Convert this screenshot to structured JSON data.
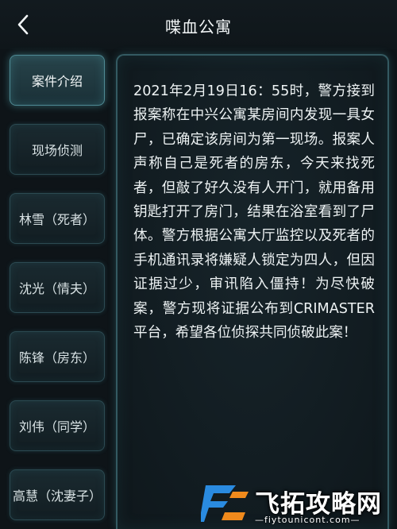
{
  "header": {
    "back_icon": "chevron-left-icon",
    "title": "喋血公寓"
  },
  "sidebar": {
    "items": [
      {
        "label": "案件介绍",
        "active": true
      },
      {
        "label": "现场侦测",
        "active": false
      },
      {
        "label": "林雪（死者）",
        "active": false
      },
      {
        "label": "沈光（情夫）",
        "active": false
      },
      {
        "label": "陈锋（房东）",
        "active": false
      },
      {
        "label": "刘伟（同学）",
        "active": false
      },
      {
        "label": "高慧（沈妻子）",
        "active": false
      }
    ]
  },
  "main": {
    "case_text": "2021年2月19日16：55时，警方接到报案称在中兴公寓某房间内发现一具女尸，已确定该房间为第一现场。报案人声称自己是死者的房东，今天来找死者，但敲了好久没有人开门，就用备用钥匙打开了房门，结果在浴室看到了尸体。警方根据公寓大厅监控以及死者的手机通讯录将嫌疑人锁定为四人，但因证据过少，审讯陷入僵持！为尽快破案，警方现将证据公布到CRIMASTER平台，希望各位侦探共同侦破此案！"
  },
  "watermark": {
    "text": "飞拓攻略网",
    "url": "—fiytounicont.com—"
  },
  "colors": {
    "background": "#0e1418",
    "panel_border": "#345a62",
    "active_border": "#4f8a94",
    "text": "#eef3f4",
    "logo_blue": "#2a8be0",
    "logo_orange": "#f08a1c"
  }
}
